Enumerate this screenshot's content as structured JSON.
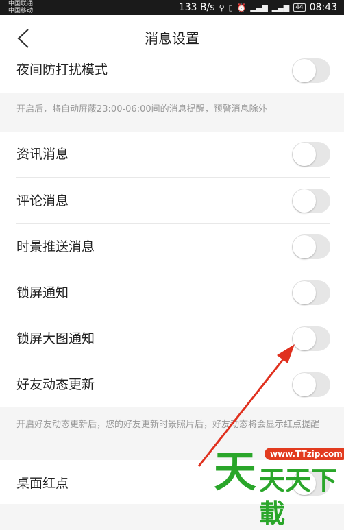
{
  "status_bar": {
    "carrier1": "中国联通",
    "carrier2": "中国移动",
    "speed": "133 B/s",
    "battery": "44",
    "time": "08:43"
  },
  "header": {
    "title": "消息设置"
  },
  "settings": {
    "dnd": {
      "label": "夜间防打扰模式",
      "on": false
    },
    "dnd_note": "开启后，将自动屏蔽23:00-06:00间的消息提醒，预警消息除外",
    "news": {
      "label": "资讯消息",
      "on": false
    },
    "comments": {
      "label": "评论消息",
      "on": false
    },
    "push": {
      "label": "时景推送消息",
      "on": false
    },
    "lock_notify": {
      "label": "锁屏通知",
      "on": false
    },
    "lock_big": {
      "label": "锁屏大图通知",
      "on": false
    },
    "friends": {
      "label": "好友动态更新",
      "on": false
    },
    "friends_note": "开启好友动态更新后，您的好友更新时景照片后，好友动态将会显示红点提醒",
    "desktop_badge": {
      "label": "桌面红点",
      "on": false
    }
  },
  "watermark": {
    "url": "www.TTzip.com",
    "text": "天天下載"
  },
  "colors": {
    "toggle_off": "#e6e6e6",
    "annotation_arrow": "#e0301e",
    "watermark_green": "#2aa62a"
  }
}
